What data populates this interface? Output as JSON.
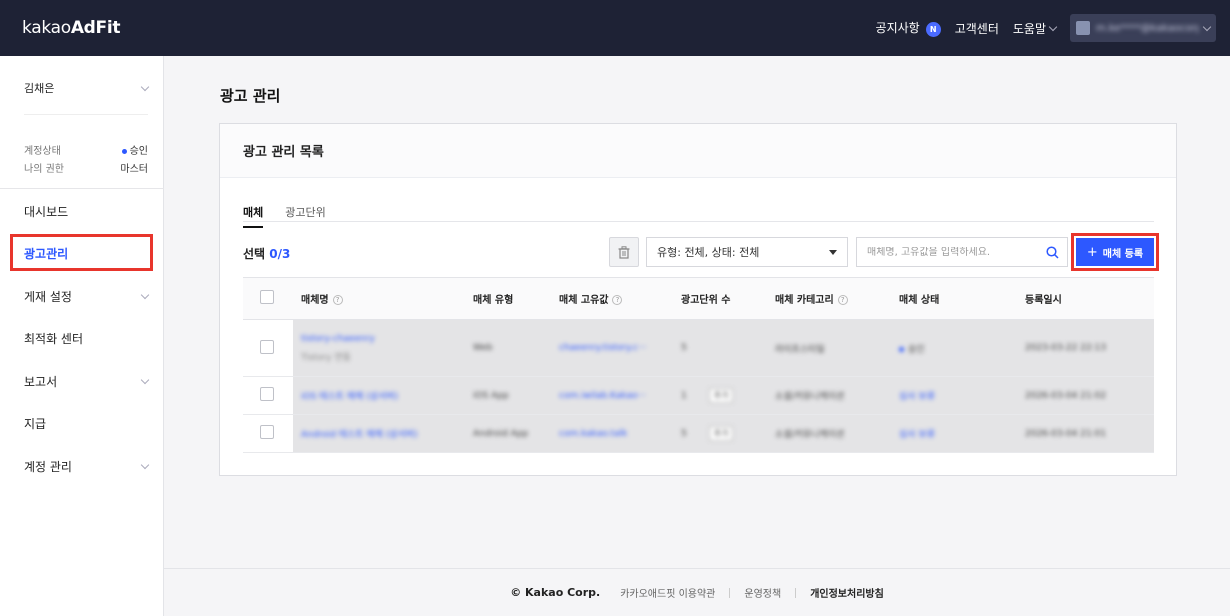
{
  "header": {
    "logo_light": "kakao",
    "logo_bold": "AdFit",
    "notice": "공지사항",
    "notice_badge": "N",
    "support": "고객센터",
    "help": "도움말",
    "account_email": "m.ke****@kakaocorp..."
  },
  "sidebar": {
    "user_name": "김채은",
    "status_label": "계정상태",
    "status_value": "승인",
    "role_label": "나의 권한",
    "role_value": "마스터",
    "menu": [
      {
        "label": "대시보드"
      },
      {
        "label": "광고관리"
      },
      {
        "label": "게재 설정"
      },
      {
        "label": "최적화 센터"
      },
      {
        "label": "보고서"
      },
      {
        "label": "지급"
      },
      {
        "label": "계정 관리"
      }
    ]
  },
  "main": {
    "page_title": "광고 관리",
    "card_title": "광고 관리 목록",
    "tabs": [
      {
        "label": "매체"
      },
      {
        "label": "광고단위"
      }
    ],
    "select_label": "선택",
    "select_count": "0/3",
    "filter_value": "유형: 전체, 상태: 전체",
    "search_placeholder": "매체명, 고유값을 입력하세요.",
    "register_label": "매체 등록",
    "columns": [
      "매체명",
      "매체 유형",
      "매체 고유값",
      "광고단위 수",
      "매체 카테고리",
      "매체 상태",
      "등록일시"
    ],
    "rows": [
      {
        "name": "tistory-chaeenry",
        "name_sub": "Tistory 연동",
        "type": "Web",
        "id": "chaeenry.tistory.c···",
        "units": "5",
        "category": "라이프스타일",
        "status": "승인",
        "date": "2023-03-22 22:13"
      },
      {
        "name": "iOS 테스트 매체 (삼서버)",
        "type": "iOS App",
        "id": "com.iwilab.Kakao···",
        "units": "1",
        "mini": "추가",
        "category": "소셜/커뮤니케이션",
        "status": "심사 보류",
        "date": "2026-03-04 21:02"
      },
      {
        "name": "Android 테스트 매체 (삼서버)",
        "type": "Android App",
        "id": "com.kakao.talk",
        "units": "5",
        "mini": "추가",
        "category": "소셜/커뮤니케이션",
        "status": "심사 보류",
        "date": "2026-03-04 21:01"
      }
    ]
  },
  "footer": {
    "copyright": "© Kakao Corp.",
    "terms": "카카오애드핏 이용약관",
    "policy": "운영정책",
    "privacy": "개인정보처리방침"
  },
  "colors": {
    "accent": "#2d58ff",
    "header_bg": "#1e2235",
    "highlight": "#e8352c"
  }
}
